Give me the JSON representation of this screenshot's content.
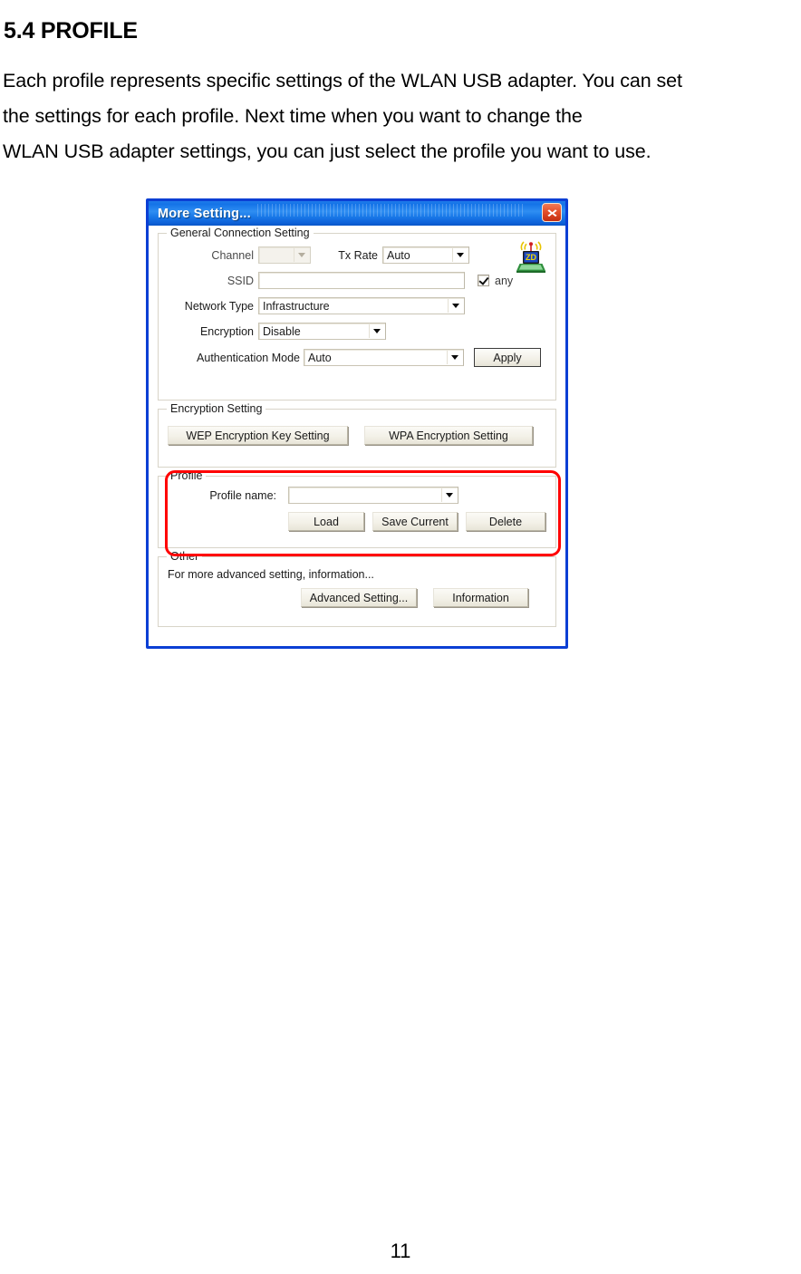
{
  "document": {
    "heading": "5.4 PROFILE",
    "paragraph_lines": [
      "Each profile represents specific settings of the WLAN USB adapter. You can set",
      "the settings for each profile. Next time when you want to change the",
      "WLAN USB adapter settings, you can just select the profile you want to use."
    ],
    "page_number": "11"
  },
  "dialog": {
    "title": "More Setting...",
    "close_label": "Close",
    "accent_title_color": "#1473e8",
    "border_color": "#0b3fd4",
    "highlight_color": "#ff0000",
    "general": {
      "legend": "General Connection Setting",
      "channel": {
        "label": "Channel",
        "value": "",
        "enabled": false
      },
      "tx_rate": {
        "label": "Tx Rate",
        "value": "Auto",
        "enabled": true
      },
      "ssid": {
        "label": "SSID",
        "value": "",
        "placeholder": ""
      },
      "any": {
        "label": "any",
        "checked": true
      },
      "network_type": {
        "label": "Network Type",
        "value": "Infrastructure"
      },
      "encryption": {
        "label": "Encryption",
        "value": "Disable"
      },
      "authentication_mode": {
        "label": "Authentication Mode",
        "value": "Auto"
      },
      "apply_label": "Apply",
      "icon_name": "wireless-laptop-icon"
    },
    "encryption_setting": {
      "legend": "Encryption Setting",
      "wep_label": "WEP Encryption Key Setting",
      "wpa_label": "WPA Encryption Setting"
    },
    "profile": {
      "legend": "Profile",
      "name_label": "Profile name:",
      "name_value": "",
      "load_label": "Load",
      "save_current_label": "Save Current",
      "delete_label": "Delete"
    },
    "other": {
      "legend": "Other",
      "note": "For more advanced setting, information...",
      "advanced_label": "Advanced Setting...",
      "information_label": "Information"
    }
  }
}
